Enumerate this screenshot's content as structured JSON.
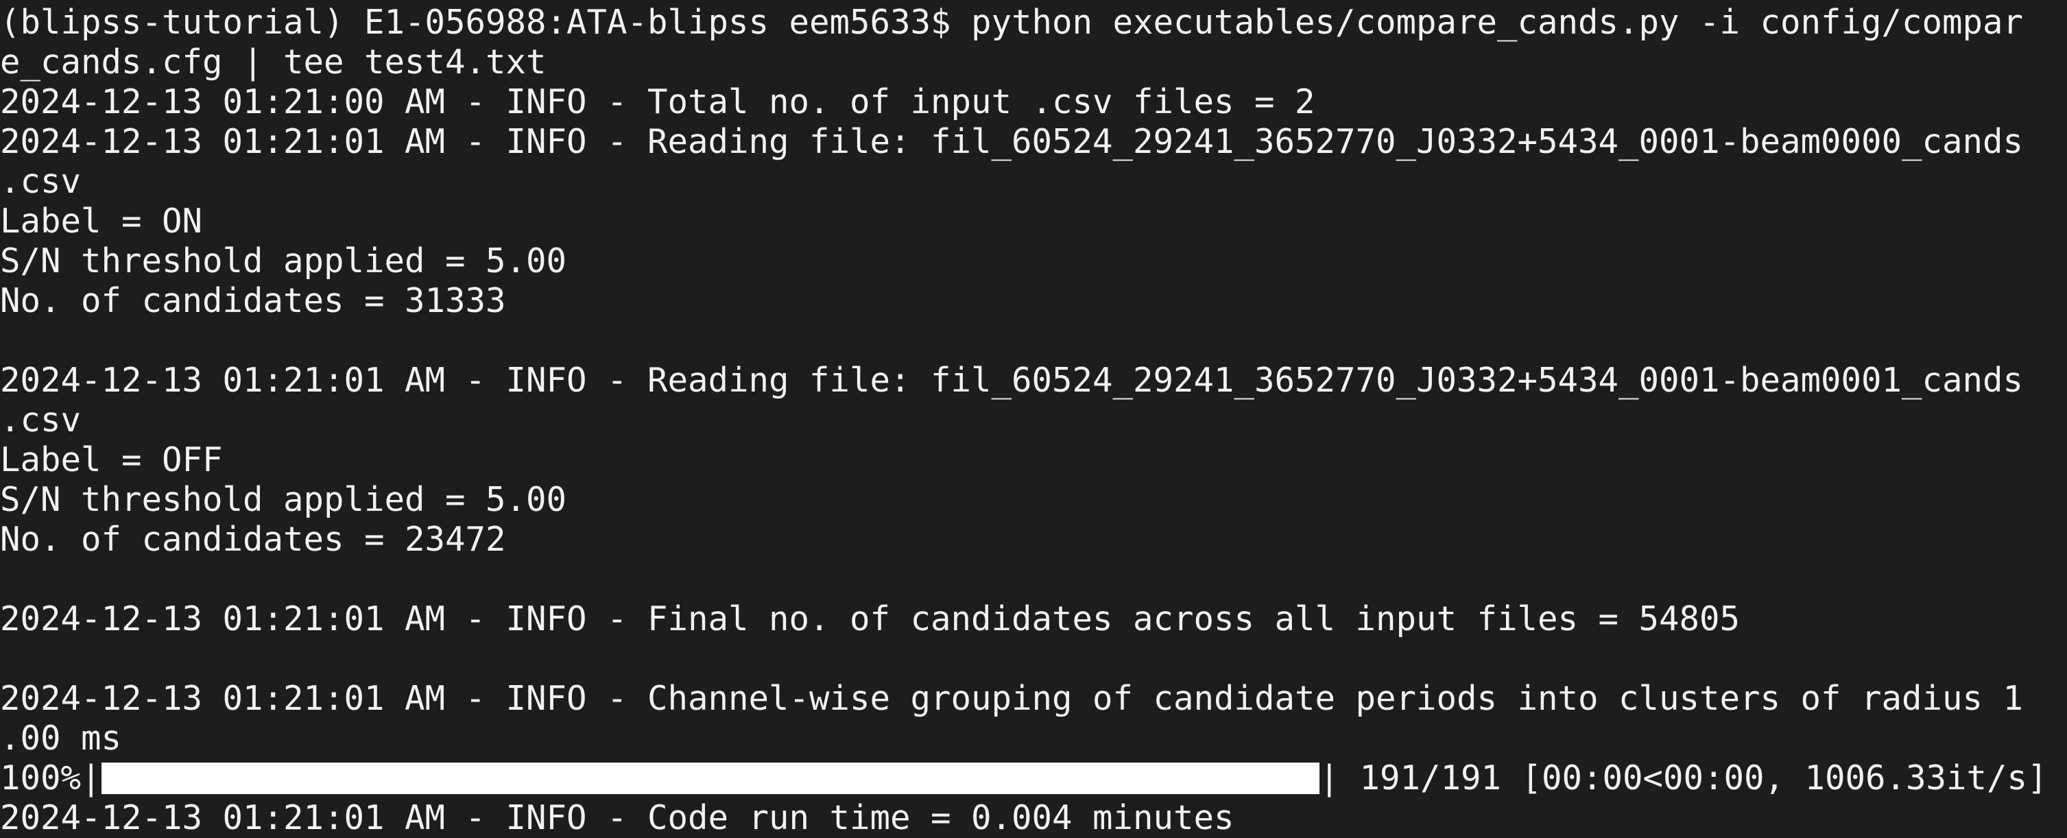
{
  "terminal": {
    "lines": [
      "(blipss-tutorial) E1-056988:ATA-blipss eem5633$ python executables/compare_cands.py -i config/compar",
      "e_cands.cfg | tee test4.txt",
      "2024-12-13 01:21:00 AM - INFO - Total no. of input .csv files = 2",
      "2024-12-13 01:21:01 AM - INFO - Reading file: fil_60524_29241_3652770_J0332+5434_0001-beam0000_cands",
      ".csv",
      "Label = ON",
      "S/N threshold applied = 5.00",
      "No. of candidates = 31333",
      "",
      "2024-12-13 01:21:01 AM - INFO - Reading file: fil_60524_29241_3652770_J0332+5434_0001-beam0001_cands",
      ".csv",
      "Label = OFF",
      "S/N threshold applied = 5.00",
      "No. of candidates = 23472",
      "",
      "2024-12-13 01:21:01 AM - INFO - Final no. of candidates across all input files = 54805",
      "",
      "2024-12-13 01:21:01 AM - INFO - Channel-wise grouping of candidate periods into clusters of radius 1",
      ".00 ms"
    ],
    "progress": {
      "percent_label": "100%|",
      "fraction": 1.0,
      "suffix": "| 191/191 [00:00<00:00, 1006.33it/s]"
    },
    "last_line": "2024-12-13 01:21:01 AM - INFO - Code run time = 0.004 minutes"
  }
}
